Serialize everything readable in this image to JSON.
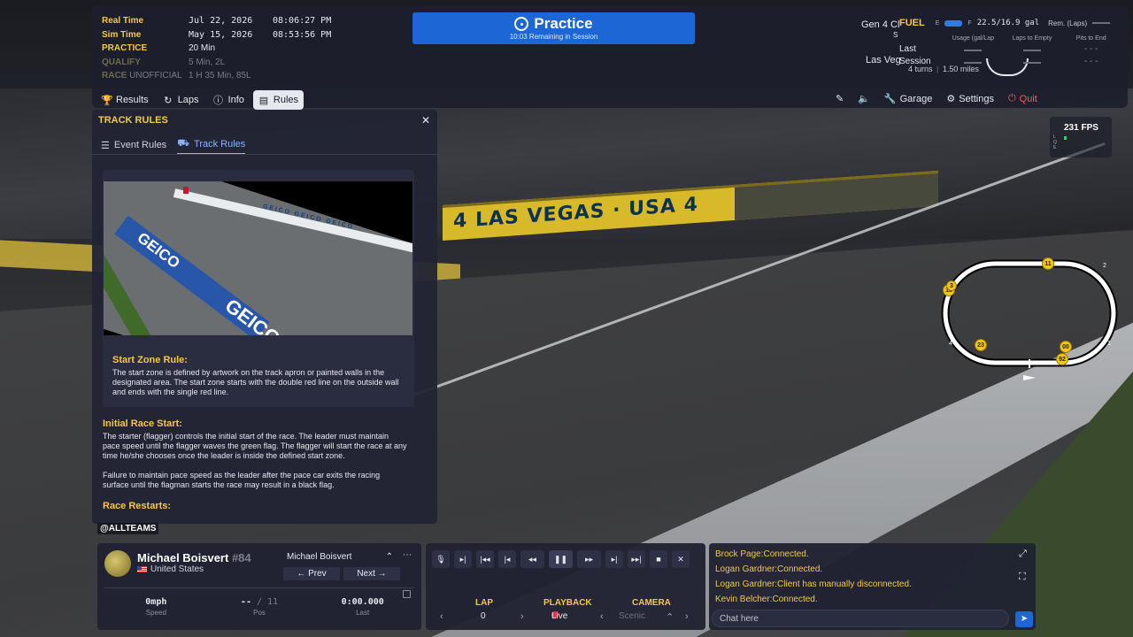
{
  "schedule": [
    {
      "label": "Real Time",
      "val1": "Jul 22, 2026",
      "val2": "08:06:27 PM"
    },
    {
      "label": "Sim Time",
      "val1": "May 15, 2026",
      "val2": "08:53:56 PM"
    },
    {
      "label": "PRACTICE",
      "val1": "20 Min",
      "val2": ""
    },
    {
      "label": "QUALIFY",
      "val1": "5 Min, 2L",
      "val2": ""
    },
    {
      "label": "RACE",
      "label_extra": "UNOFFICIAL",
      "val1": "1 H 35 Min, 85L",
      "val2": ""
    }
  ],
  "session": {
    "title": "Practice",
    "remaining": "10:03 Remaining in Session"
  },
  "car": {
    "name": "Gen 4 Cl",
    "name_suffix": "S",
    "location": "Las Veg",
    "turns": "4 turns",
    "length": "1.50 miles"
  },
  "fuel": {
    "label": "FUEL",
    "empty": "E",
    "full": "F",
    "amount": "22.5/16.9 gal",
    "rem_label": "Rem. (Laps)",
    "columns": [
      "Usage (gal/Lap",
      "Laps to Empty",
      "Pits to End"
    ],
    "rows": [
      {
        "name": "Last",
        "pits": "- - -"
      },
      {
        "name": "Session",
        "pits": "- - -"
      }
    ]
  },
  "nav_tabs": [
    {
      "label": "Results",
      "icon": "trophy-icon"
    },
    {
      "label": "Laps",
      "icon": "laps-icon"
    },
    {
      "label": "Info",
      "icon": "info-icon"
    },
    {
      "label": "Rules",
      "icon": "rules-icon",
      "active": true
    }
  ],
  "right_nav": {
    "garage": "Garage",
    "settings": "Settings",
    "quit": "Quit"
  },
  "rules_panel": {
    "title": "TRACK RULES",
    "tabs": [
      "Event Rules",
      "Track Rules"
    ],
    "photo_texts": {
      "brand": "GEICO",
      "brand_big": "GEICO",
      "wall": "GEICO GEICO GEICO"
    },
    "start_zone_heading": "Start Zone Rule:",
    "start_zone_text": "The start zone is defined by artwork on the track apron or painted walls in the designated area.  The start zone starts with the double red line on the outside wall and ends with the single red line.",
    "initial_heading": "Initial Race Start:",
    "initial_text": "The starter (flagger) controls the initial start of the race. The leader must maintain pace speed until the flagger waves the green flag. The flagger will start the race at any time he/she chooses once the leader is inside the defined start zone.",
    "initial_text2": "Failure to maintain pace speed as the leader after the pace car exits the racing surface until the flagman starts the race may result in a black flag.",
    "restarts_heading": "Race Restarts:"
  },
  "overlay_tag": "@ALLTEAMS",
  "driver": {
    "name": "Michael Boisvert",
    "number": "#84",
    "country": "United States",
    "selected": "Michael Boisvert",
    "prev": "Prev",
    "next": "Next",
    "speed_value": "0mph",
    "speed_label": "Speed",
    "pos_value": "--",
    "pos_total": "/ 11",
    "pos_label": "Pos",
    "last_value": "0:00.000",
    "last_label": "Last"
  },
  "playback": {
    "lap_label": "LAP",
    "lap_value": "0",
    "playback_label": "PLAYBACK",
    "playback_value": "Live",
    "camera_label": "CAMERA",
    "camera_value": "Scenic"
  },
  "chat": {
    "messages": [
      "Brock Page:Connected.",
      "Logan Gardner:Connected.",
      "Logan Gardner:Client has manually disconnected.",
      "Kevin Belcher:Connected."
    ],
    "placeholder": "Chat here"
  },
  "fps": {
    "value": "231  FPS",
    "lqe": [
      "L",
      "Q",
      "E"
    ]
  },
  "scene": {
    "banner": "4 LAS VEGAS · USA 4"
  },
  "track_map": {
    "cars": [
      "11",
      "18",
      "3",
      "23",
      "00",
      "92"
    ],
    "turns": [
      "1",
      "2",
      "4"
    ]
  }
}
